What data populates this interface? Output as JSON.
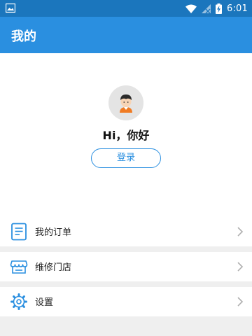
{
  "status_bar": {
    "time": "6:01",
    "icons": [
      "image-icon",
      "wifi-icon",
      "signal-icon",
      "battery-charging-icon"
    ]
  },
  "app_bar": {
    "title": "我的"
  },
  "profile": {
    "greeting": "Hi，你好",
    "login_label": "登录"
  },
  "menu": {
    "orders": {
      "label": "我的订单",
      "icon": "document-list-icon"
    },
    "stores": {
      "label": "维修门店",
      "icon": "storefront-icon"
    },
    "settings": {
      "label": "设置",
      "icon": "gear-icon"
    }
  },
  "colors": {
    "accent": "#2a8fe0",
    "status_bar": "#1b76bd",
    "background": "#efefef"
  }
}
